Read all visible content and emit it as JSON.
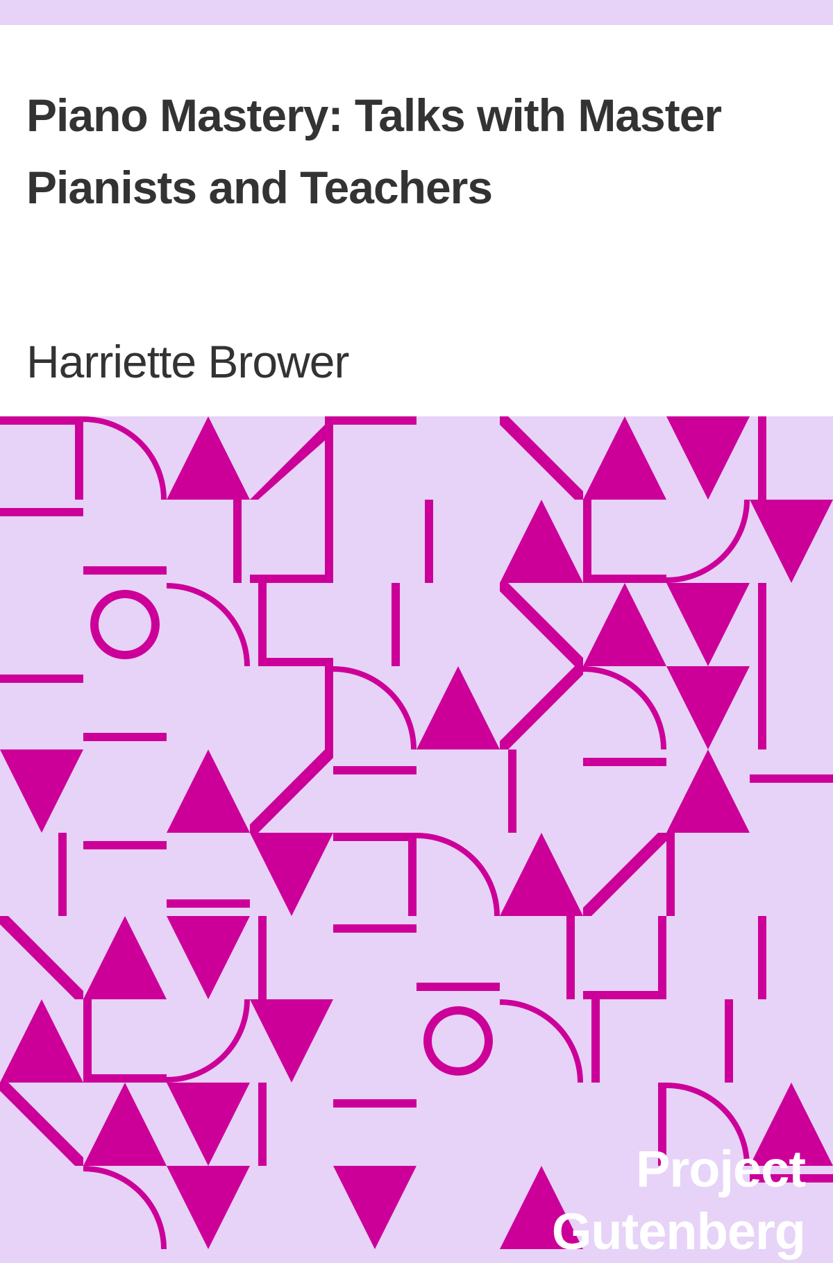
{
  "book": {
    "title": "Piano Mastery: Talks with Master Pianists and Teachers",
    "author": "Harriette Brower"
  },
  "publisher": {
    "label": "Project Gutenberg"
  },
  "colors": {
    "background": "#e6d3f7",
    "panel": "#ffffff",
    "pattern": "#cc0099",
    "text": "#333333",
    "publisher_text": "#ffffff"
  }
}
